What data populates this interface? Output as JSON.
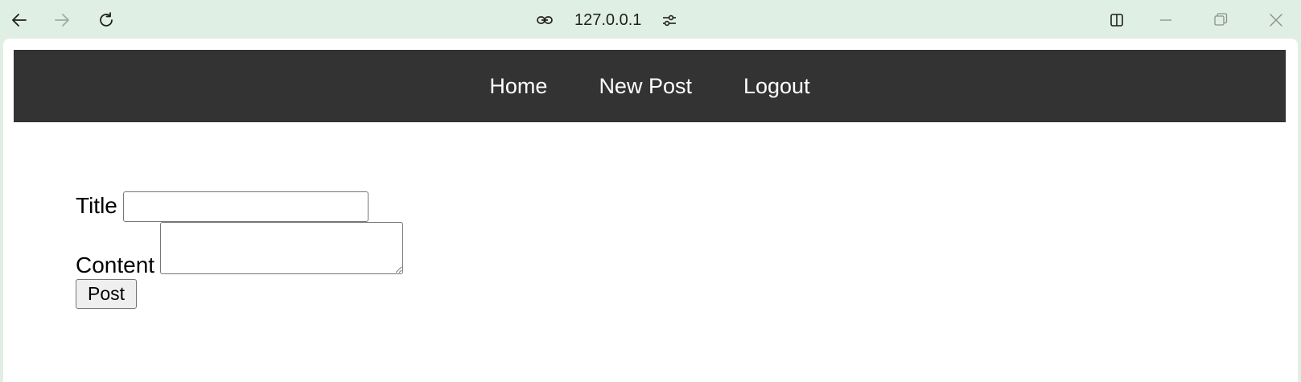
{
  "browser": {
    "url": "127.0.0.1",
    "icons": {
      "back": "back-arrow-icon",
      "forward": "forward-arrow-icon",
      "reload": "reload-icon",
      "site_info": "link-icon",
      "page_settings": "sliders-icon",
      "split_view": "split-view-icon",
      "minimize": "minimize-icon",
      "maximize": "restore-icon",
      "close": "close-icon"
    }
  },
  "nav": {
    "items": [
      {
        "label": "Home"
      },
      {
        "label": "New Post"
      },
      {
        "label": "Logout"
      }
    ],
    "background": "#333333",
    "text_color": "#ffffff"
  },
  "form": {
    "title_label": "Title",
    "title_value": "",
    "content_label": "Content",
    "content_value": "",
    "submit_label": "Post"
  },
  "colors": {
    "chrome": "#e0efe4",
    "page": "#ffffff"
  }
}
